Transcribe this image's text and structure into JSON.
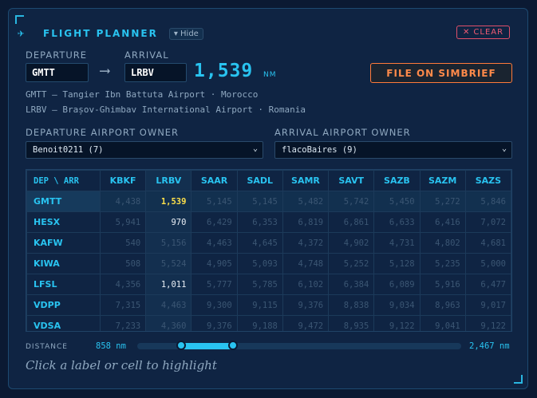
{
  "header": {
    "icon": "plane-icon",
    "title": "FLIGHT PLANNER",
    "hide_label": "▾ Hide",
    "clear_label": "CLEAR"
  },
  "route": {
    "departure_label": "DEPARTURE",
    "arrival_label": "ARRIVAL",
    "departure_code": "GMTT",
    "arrival_code": "LRBV",
    "distance": "1,539",
    "distance_unit": "NM",
    "file_label": "FILE ON SIMBRIEF",
    "departure_desc": "GMTT — Tangier Ibn Battuta Airport · Morocco",
    "arrival_desc": "LRBV — Brașov-Ghimbav International Airport · Romania"
  },
  "owners": {
    "departure_label": "DEPARTURE AIRPORT OWNER",
    "arrival_label": "ARRIVAL AIRPORT OWNER",
    "departure_value": "Benoit0211 (7)",
    "arrival_value": "flacoBaires (9)"
  },
  "matrix": {
    "corner_label": "DEP \\ ARR",
    "columns": [
      "KBKF",
      "LRBV",
      "SAAR",
      "SADL",
      "SAMR",
      "SAVT",
      "SAZB",
      "SAZM",
      "SAZS"
    ],
    "rows": [
      {
        "code": "GMTT",
        "values": [
          "4,438",
          "1,539",
          "5,145",
          "5,145",
          "5,482",
          "5,742",
          "5,450",
          "5,272",
          "5,846"
        ]
      },
      {
        "code": "HESX",
        "values": [
          "5,941",
          "970",
          "6,429",
          "6,353",
          "6,819",
          "6,861",
          "6,633",
          "6,416",
          "7,072"
        ]
      },
      {
        "code": "KAFW",
        "values": [
          "540",
          "5,156",
          "4,463",
          "4,645",
          "4,372",
          "4,902",
          "4,731",
          "4,802",
          "4,681"
        ]
      },
      {
        "code": "KIWA",
        "values": [
          "508",
          "5,524",
          "4,905",
          "5,093",
          "4,748",
          "5,252",
          "5,128",
          "5,235",
          "5,000"
        ]
      },
      {
        "code": "LFSL",
        "values": [
          "4,356",
          "1,011",
          "5,777",
          "5,785",
          "6,102",
          "6,384",
          "6,089",
          "5,916",
          "6,477"
        ]
      },
      {
        "code": "VDPP",
        "values": [
          "7,315",
          "4,463",
          "9,300",
          "9,115",
          "9,376",
          "8,838",
          "9,034",
          "8,963",
          "9,017"
        ]
      },
      {
        "code": "VDSA",
        "values": [
          "7,233",
          "4,360",
          "9,376",
          "9,188",
          "9,472",
          "8,935",
          "9,122",
          "9,041",
          "9,122"
        ]
      }
    ],
    "highlight_row": 0,
    "highlight_col": 1,
    "in_range_cells": [
      [
        0,
        1
      ],
      [
        1,
        1
      ],
      [
        4,
        1
      ]
    ]
  },
  "distance_filter": {
    "label": "DISTANCE",
    "min_label": "858 nm",
    "max_label": "2,467 nm",
    "range_min": 0,
    "range_max": 10000,
    "low": 858,
    "high": 2467
  },
  "hint": "Click a label or cell to highlight",
  "colors": {
    "accent": "#29c3f0",
    "danger": "#f05a72",
    "action": "#ff8a4a",
    "selected_cell": "#ffe14a"
  }
}
